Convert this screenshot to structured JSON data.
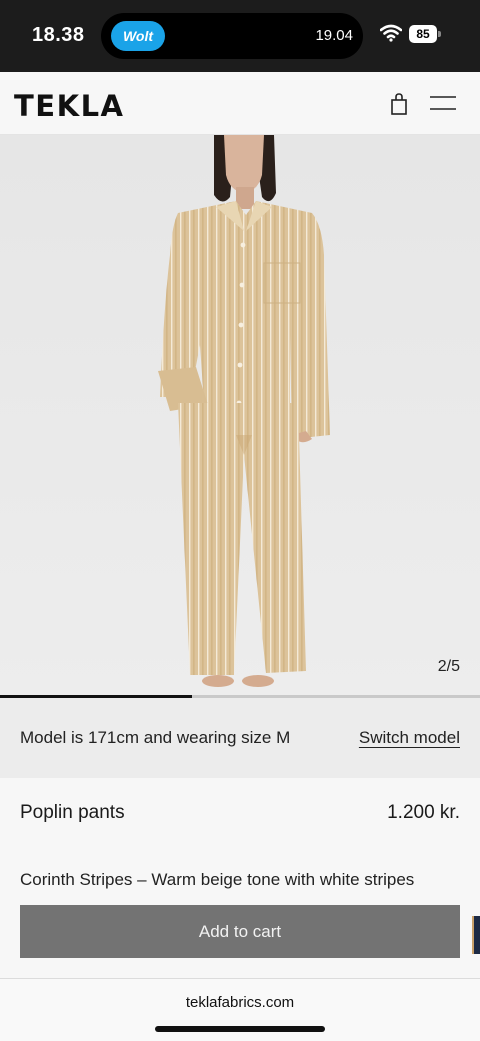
{
  "status_bar": {
    "time": "18.38",
    "app_pill": "Wolt",
    "island_time": "19.04",
    "battery": "85"
  },
  "header": {
    "logo": "TEKLA"
  },
  "gallery": {
    "counter": "2/5",
    "current_index": 2,
    "total": 5,
    "progress_fraction": 0.4
  },
  "model_info": {
    "text": "Model is 171cm and wearing size M",
    "switch_label": "Switch model"
  },
  "product": {
    "name": "Poplin pants",
    "price": "1.200 kr.",
    "description": "Corinth Stripes – Warm beige tone with white stripes",
    "add_to_cart_label": "Add to cart"
  },
  "browser": {
    "url": "teklafabrics.com"
  },
  "colors": {
    "brand_accent": "#1aa3e8",
    "button_bg": "#737373",
    "garment": "#dcc39a"
  },
  "icons": [
    "wifi-icon",
    "shopping-bag-icon",
    "menu-icon"
  ]
}
